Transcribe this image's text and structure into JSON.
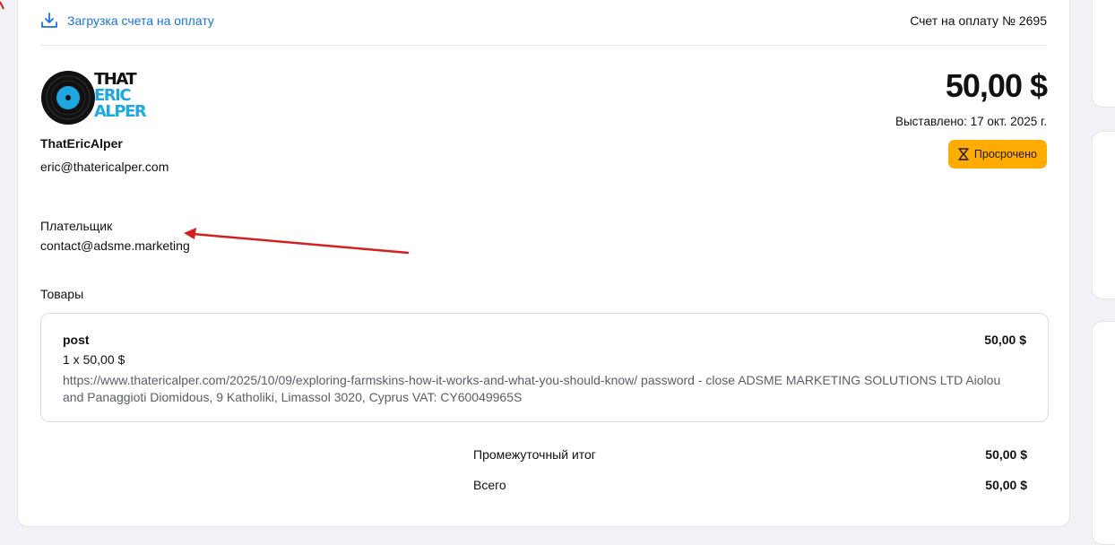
{
  "header": {
    "download_label": "Загрузка счета на оплату",
    "invoice_number": "Счет на оплату № 2695"
  },
  "seller": {
    "logo_text": [
      "THAT",
      "ERIC",
      "ALPER"
    ],
    "name": "ThatEricAlper",
    "email": "eric@thatericalper.com"
  },
  "summary": {
    "amount": "50,00 $",
    "issued": "Выставлено: 17 окт. 2025 г.",
    "status": "Просрочено"
  },
  "payer": {
    "label": "Плательщик",
    "email": "contact@adsme.marketing"
  },
  "goods": {
    "label": "Товары",
    "items": [
      {
        "name": "post",
        "price": "50,00 $",
        "qty": "1 x 50,00 $",
        "description": "https://www.thatericalper.com/2025/10/09/exploring-farmskins-how-it-works-and-what-you-should-know/ password - close ADSME MARKETING SOLUTIONS LTD Aiolou and Panaggioti Diomidous, 9 Katholiki, Limassol 3020, Cyprus VAT: CY60049965S"
      }
    ]
  },
  "totals": {
    "subtotal_label": "Промежуточный итог",
    "subtotal_value": "50,00 $",
    "total_label": "Всего",
    "total_value": "50,00 $"
  },
  "colors": {
    "link": "#1a73d9",
    "status_badge": "#ffab00",
    "annotation_arrow": "#d42020",
    "logo_blue": "#1ea7e1"
  },
  "icons": [
    "download-icon",
    "hourglass-icon",
    "vinyl-record-icon"
  ]
}
